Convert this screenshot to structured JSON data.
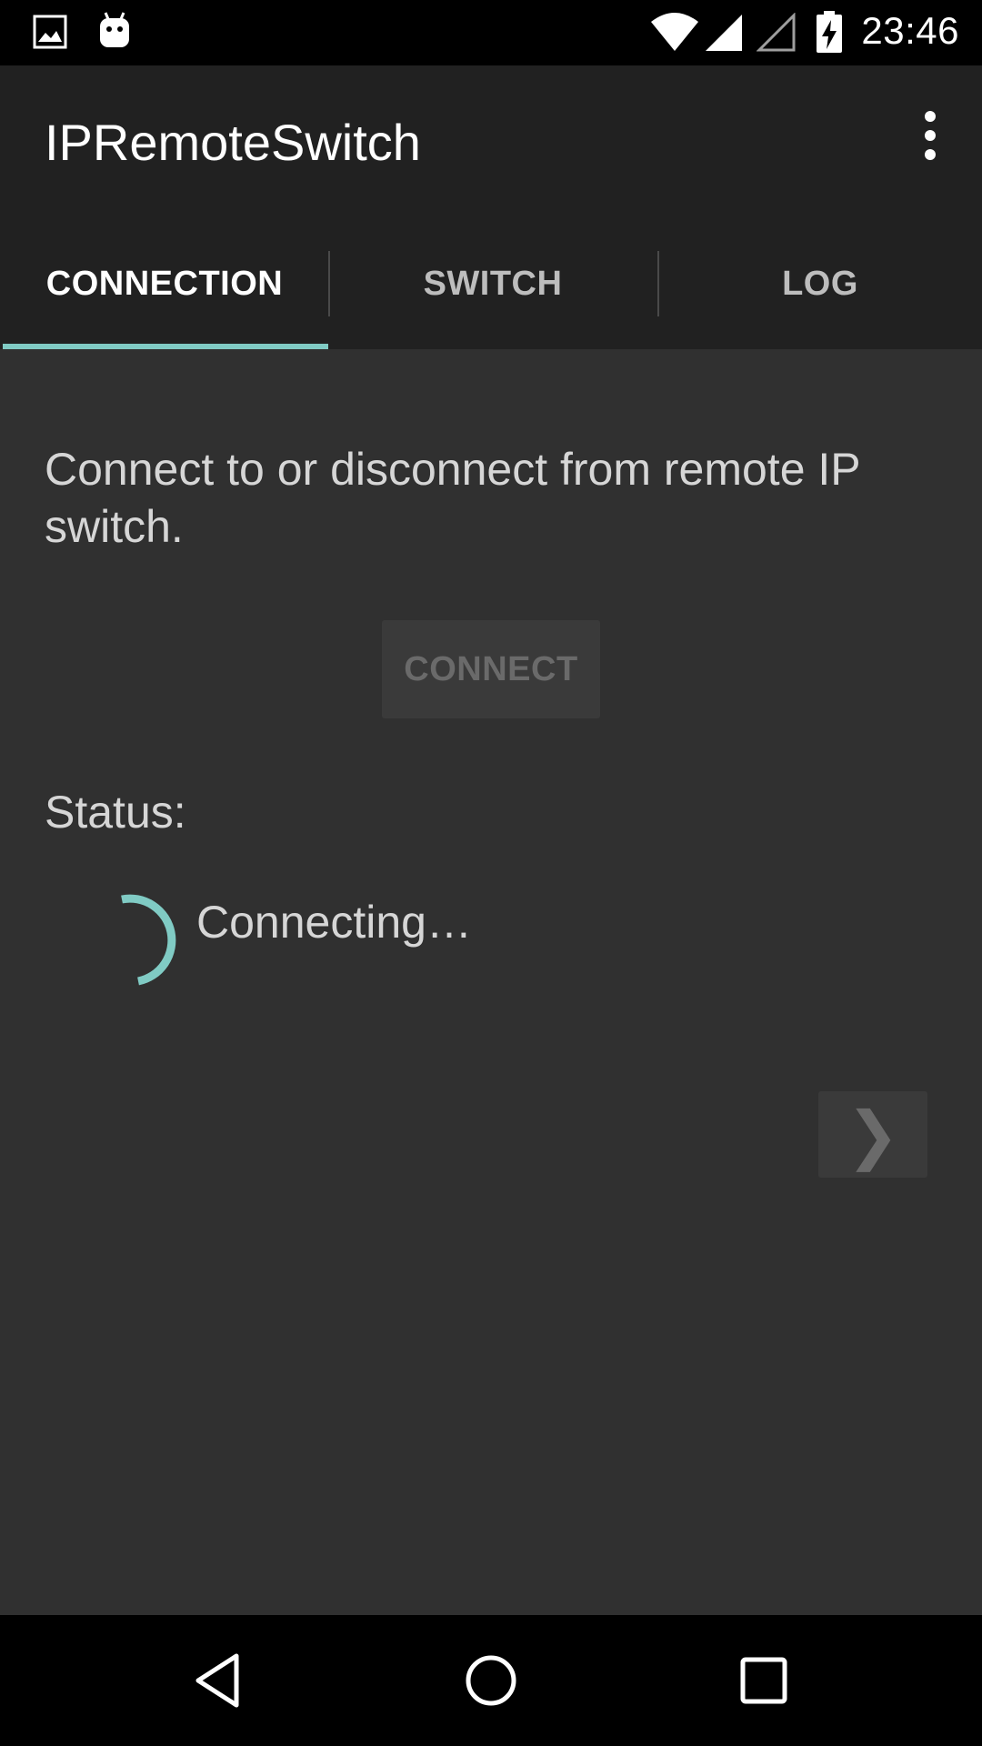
{
  "status_bar": {
    "time": "23:46",
    "icons": [
      "image-notification-icon",
      "android-debug-icon",
      "wifi-icon",
      "cell-signal-icon",
      "cell-signal-empty-icon",
      "battery-charging-icon"
    ]
  },
  "app_bar": {
    "title": "IPRemoteSwitch",
    "overflow_icon": "more-vert-icon"
  },
  "tabs": [
    {
      "label": "CONNECTION",
      "active": true
    },
    {
      "label": "SWITCH",
      "active": false
    },
    {
      "label": "LOG",
      "active": false
    }
  ],
  "main": {
    "description": "Connect to or disconnect from remote IP switch.",
    "connect_label": "CONNECT",
    "status_label": "Status:",
    "status_value": "Connecting…",
    "next_symbol": "❯"
  },
  "nav_bar": {
    "icons": [
      "back-icon",
      "home-icon",
      "recents-icon"
    ]
  },
  "colors": {
    "accent": "#80cbc4",
    "background": "#303030",
    "app_bar": "#212121",
    "status_bar": "#000000"
  }
}
